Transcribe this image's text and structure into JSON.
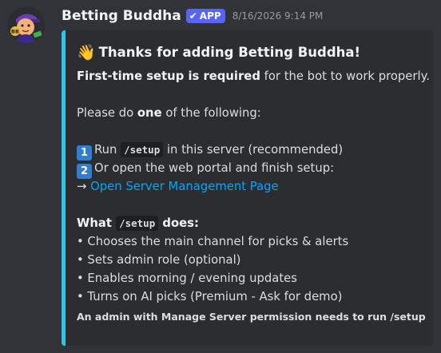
{
  "bot": {
    "name": "Betting Buddha",
    "badge": "APP",
    "timestamp": "8/16/2026 9:14 PM"
  },
  "embed": {
    "accent_color": "#2ec5ec",
    "title_emoji": "👋",
    "title": "Thanks for adding Betting Buddha!",
    "intro_bold": "First-time setup is required",
    "intro_rest": " for the bot to work properly.",
    "please_a": "Please do ",
    "please_bold": "one",
    "please_b": " of the following:",
    "step1_key": "1",
    "step1_a": "Run ",
    "step1_code": "/setup",
    "step1_b": " in this server (recommended)",
    "step2_key": "2",
    "step2_text": "Or open the web portal and finish setup:",
    "arrow": "→ ",
    "portal_link": "Open Server Management Page",
    "what_a": "What ",
    "what_code": "/setup",
    "what_b": " does:",
    "bullets": [
      "• Chooses the main channel for picks & alerts",
      "• Sets admin role (optional)",
      "• Enables morning / evening updates",
      "• Turns on AI picks (Premium - Ask for demo)"
    ],
    "footer": "An admin with Manage Server permission needs to run /setup"
  }
}
